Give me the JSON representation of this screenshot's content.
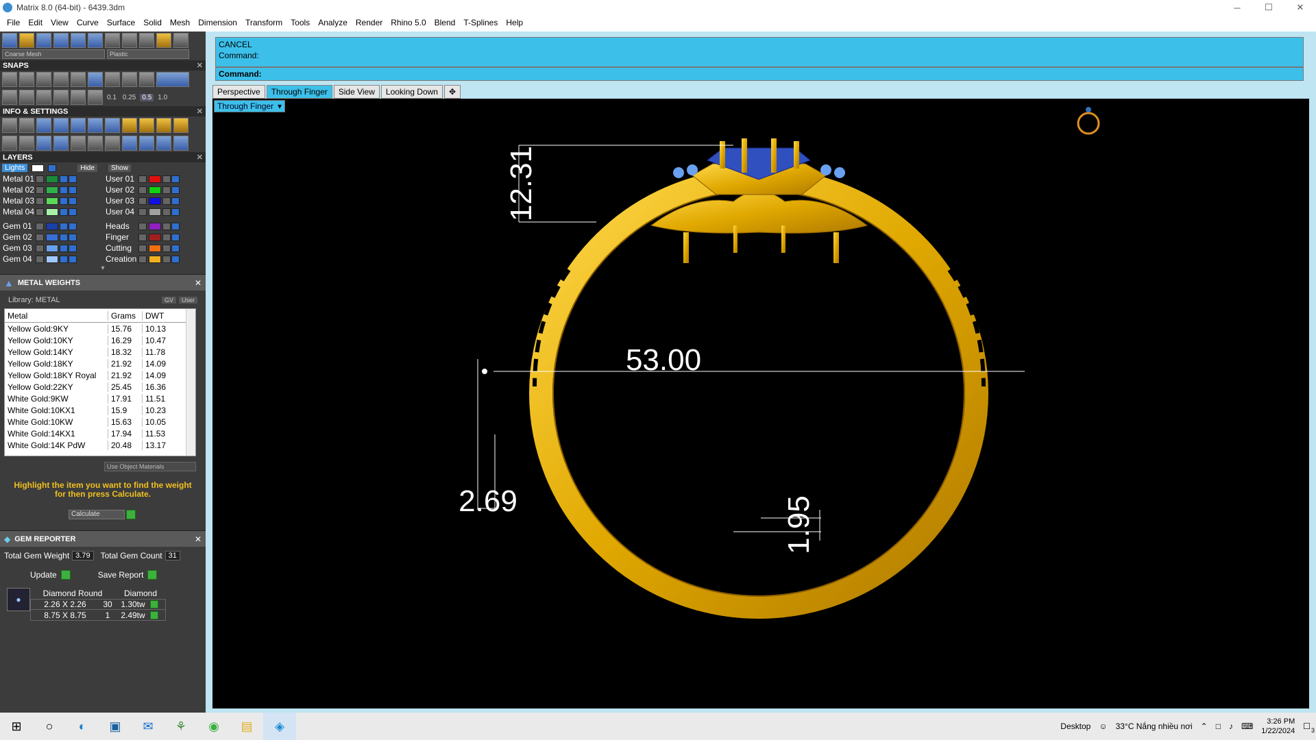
{
  "window": {
    "title": "Matrix 8.0 (64-bit) - 6439.3dm"
  },
  "menu": [
    "File",
    "Edit",
    "View",
    "Curve",
    "Surface",
    "Solid",
    "Mesh",
    "Dimension",
    "Transform",
    "Tools",
    "Analyze",
    "Render",
    "Rhino 5.0",
    "Blend",
    "T-Splines",
    "Help"
  ],
  "toolbar": {
    "mesh_dropdown": "Coarse Mesh",
    "material_dropdown": "Plastic"
  },
  "snaps": {
    "title": "SNAPS",
    "values": [
      "0.1",
      "0.25",
      "0.5",
      "1.0"
    ]
  },
  "info": {
    "title": "INFO & SETTINGS"
  },
  "layers": {
    "title": "LAYERS",
    "lights_label": "Lights",
    "hide_label": "Hide",
    "show_label": "Show",
    "left": [
      {
        "name": "Metal 01",
        "color": "#1a8a3a"
      },
      {
        "name": "Metal 02",
        "color": "#2fb04a"
      },
      {
        "name": "Metal 03",
        "color": "#5ad85a"
      },
      {
        "name": "Metal 04",
        "color": "#a8f0a8"
      },
      {
        "name": "Gem 01",
        "color": "#1a3fa8"
      },
      {
        "name": "Gem 02",
        "color": "#3a6fd8"
      },
      {
        "name": "Gem 03",
        "color": "#6aa0f0"
      },
      {
        "name": "Gem 04",
        "color": "#a0c8ff"
      }
    ],
    "right": [
      {
        "name": "User 01",
        "color": "#e01010"
      },
      {
        "name": "User 02",
        "color": "#10d010"
      },
      {
        "name": "User 03",
        "color": "#1010e0"
      },
      {
        "name": "User 04",
        "color": "#a0a0a0"
      },
      {
        "name": "Heads",
        "color": "#9020c0"
      },
      {
        "name": "Finger",
        "color": "#a02020"
      },
      {
        "name": "Cutting",
        "color": "#f07010"
      },
      {
        "name": "Creation",
        "color": "#f0b020"
      }
    ]
  },
  "metal_weights": {
    "title": "METAL WEIGHTS",
    "library": "Library: METAL",
    "gv_label": "GV",
    "user_label": "User",
    "headers": [
      "Metal",
      "Grams",
      "DWT"
    ],
    "rows": [
      [
        "Yellow Gold:9KY",
        "15.76",
        "10.13"
      ],
      [
        "Yellow Gold:10KY",
        "16.29",
        "10.47"
      ],
      [
        "Yellow Gold:14KY",
        "18.32",
        "11.78"
      ],
      [
        "Yellow Gold:18KY",
        "21.92",
        "14.09"
      ],
      [
        "Yellow Gold:18KY Royal",
        "21.92",
        "14.09"
      ],
      [
        "Yellow Gold:22KY",
        "25.45",
        "16.36"
      ],
      [
        "White Gold:9KW",
        "17.91",
        "11.51"
      ],
      [
        "White Gold:10KX1",
        "15.9",
        "10.23"
      ],
      [
        "White Gold:10KW",
        "15.63",
        "10.05"
      ],
      [
        "White Gold:14KX1",
        "17.94",
        "11.53"
      ],
      [
        "White Gold:14K PdW",
        "20.48",
        "13.17"
      ]
    ],
    "use_object_materials": "Use Object Materials",
    "hint": "Highlight the item you want to find the weight for then press Calculate.",
    "calculate": "Calculate"
  },
  "gem_reporter": {
    "title": "GEM REPORTER",
    "total_weight_label": "Total Gem Weight",
    "total_weight": "3.79",
    "total_count_label": "Total Gem Count",
    "total_count": "31",
    "update": "Update",
    "save_report": "Save Report",
    "headers": [
      "Diamond Round",
      "Diamond"
    ],
    "rows": [
      [
        "2.26 X 2.26",
        "30",
        "1.30tw"
      ],
      [
        "8.75 X 8.75",
        "1",
        "2.49tw"
      ]
    ]
  },
  "command": {
    "line1": "CANCEL",
    "line2": "Command:",
    "prompt": "Command:"
  },
  "tabs": [
    "Perspective",
    "Through Finger",
    "Side View",
    "Looking Down"
  ],
  "active_tab": 1,
  "viewport": {
    "dropdown": "Through Finger",
    "dims": {
      "height": "12.31",
      "diameter": "53.00",
      "thickness": "2.69",
      "band": "1.95"
    }
  },
  "taskbar": {
    "desktop": "Desktop",
    "weather": "33°C  Nắng nhiều nơi",
    "time": "3:26 PM",
    "date": "1/22/2024",
    "notifications": "3"
  }
}
